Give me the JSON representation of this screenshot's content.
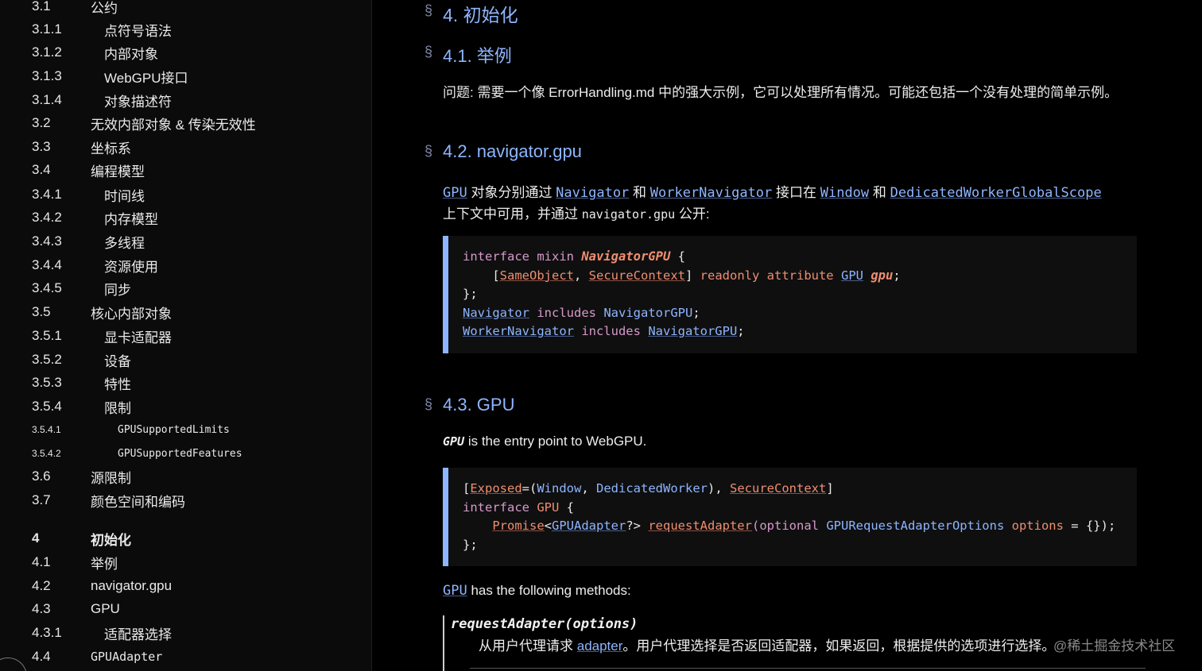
{
  "toc": [
    {
      "num": "3.1",
      "label": "公约"
    },
    {
      "num": "3.1.1",
      "label": "点符号语法"
    },
    {
      "num": "3.1.2",
      "label": "内部对象"
    },
    {
      "num": "3.1.3",
      "label": "WebGPU接口"
    },
    {
      "num": "3.1.4",
      "label": "对象描述符"
    },
    {
      "num": "3.2",
      "label": "无效内部对象 & 传染无效性"
    },
    {
      "num": "3.3",
      "label": "坐标系"
    },
    {
      "num": "3.4",
      "label": "编程模型"
    },
    {
      "num": "3.4.1",
      "label": "时间线"
    },
    {
      "num": "3.4.2",
      "label": "内存模型"
    },
    {
      "num": "3.4.3",
      "label": "多线程"
    },
    {
      "num": "3.4.4",
      "label": "资源使用"
    },
    {
      "num": "3.4.5",
      "label": "同步"
    },
    {
      "num": "3.5",
      "label": "核心内部对象"
    },
    {
      "num": "3.5.1",
      "label": "显卡适配器"
    },
    {
      "num": "3.5.2",
      "label": "设备"
    },
    {
      "num": "3.5.3",
      "label": "特性"
    },
    {
      "num": "3.5.4",
      "label": "限制"
    },
    {
      "num": "3.5.4.1",
      "label": "GPUSupportedLimits"
    },
    {
      "num": "3.5.4.2",
      "label": "GPUSupportedFeatures"
    },
    {
      "num": "3.6",
      "label": "源限制"
    },
    {
      "num": "3.7",
      "label": "颜色空间和编码"
    },
    {
      "num": "4",
      "label": "初始化"
    },
    {
      "num": "4.1",
      "label": "举例"
    },
    {
      "num": "4.2",
      "label": "navigator.gpu"
    },
    {
      "num": "4.3",
      "label": "GPU"
    },
    {
      "num": "4.3.1",
      "label": "适配器选择"
    },
    {
      "num": "4.4",
      "label": "GPUAdapter"
    }
  ],
  "main": {
    "section_mark": "§",
    "h4": "4. 初始化",
    "h41": "4.1. 举例",
    "p41": "问题: 需要一个像 ErrorHandling.md 中的强大示例，它可以处理所有情况。可能还包括一个没有处理的简单示例。",
    "h42": "4.2. navigator.gpu",
    "p42": {
      "gpu": "GPU",
      "t1": " 对象分别通过 ",
      "navigator": "Navigator",
      "t2": " 和 ",
      "worker_navigator": "WorkerNavigator",
      "t3": " 接口在 ",
      "window": "Window",
      "t4": " 和 ",
      "dedicated_scope": "DedicatedWorkerGlobalScope",
      "line2a": "上下文中可用，并通过 ",
      "line2code": "navigator.gpu",
      "line2b": " 公开:"
    },
    "h43": "4.3. GPU",
    "p43": {
      "gpu": "GPU",
      "text": " is the entry point to WebGPU."
    },
    "p43b": {
      "gpu": "GPU",
      "text": " has the following methods:"
    },
    "dfn_title": "requestAdapter(options)",
    "dfn_desc_a": "从用户代理请求 ",
    "dfn_desc_link": "adapter",
    "dfn_desc_b": "。用户代理选择是否返回适配器，如果返回，根据提供的选项进行选择。"
  },
  "code1": {
    "l1_kw": "interface mixin ",
    "l1_name": "NavigatorGPU",
    "l1_end": " {",
    "l2_open": "    [",
    "l2_same": "SameObject",
    "l2_comma": ", ",
    "l2_secure": "SecureContext",
    "l2_close": "] ",
    "l2_kw": "readonly attribute ",
    "l2_type": "GPU",
    "l2_sp": " ",
    "l2_name": "gpu",
    "l2_end": ";",
    "l3": "};",
    "l4_a": "Navigator",
    "l4_kw": " includes ",
    "l4_b": "NavigatorGPU",
    "l4_end": ";",
    "l5_a": "WorkerNavigator",
    "l5_kw": " includes ",
    "l5_b": "NavigatorGPU",
    "l5_end": ";"
  },
  "code2": {
    "l1_open": "[",
    "l1_exposed": "Exposed",
    "l1_eq": "=(",
    "l1_window": "Window",
    "l1_comma": ", ",
    "l1_dw": "DedicatedWorker",
    "l1_close": "), ",
    "l1_secure": "SecureContext",
    "l1_end": "]",
    "l2_kw": "interface ",
    "l2_name": "GPU",
    "l2_end": " {",
    "l3_indent": "    ",
    "l3_promise": "Promise",
    "l3_lt": "<",
    "l3_adapter": "GPUAdapter",
    "l3_gt": "?> ",
    "l3_method": "requestAdapter",
    "l3_paren": "(",
    "l3_opt": "optional ",
    "l3_opttype": "GPURequestAdapterOptions",
    "l3_sp": " ",
    "l3_arg": "options",
    "l3_end": " = {});",
    "l4": "};"
  },
  "watermark": "@稀土掘金技术社区"
}
